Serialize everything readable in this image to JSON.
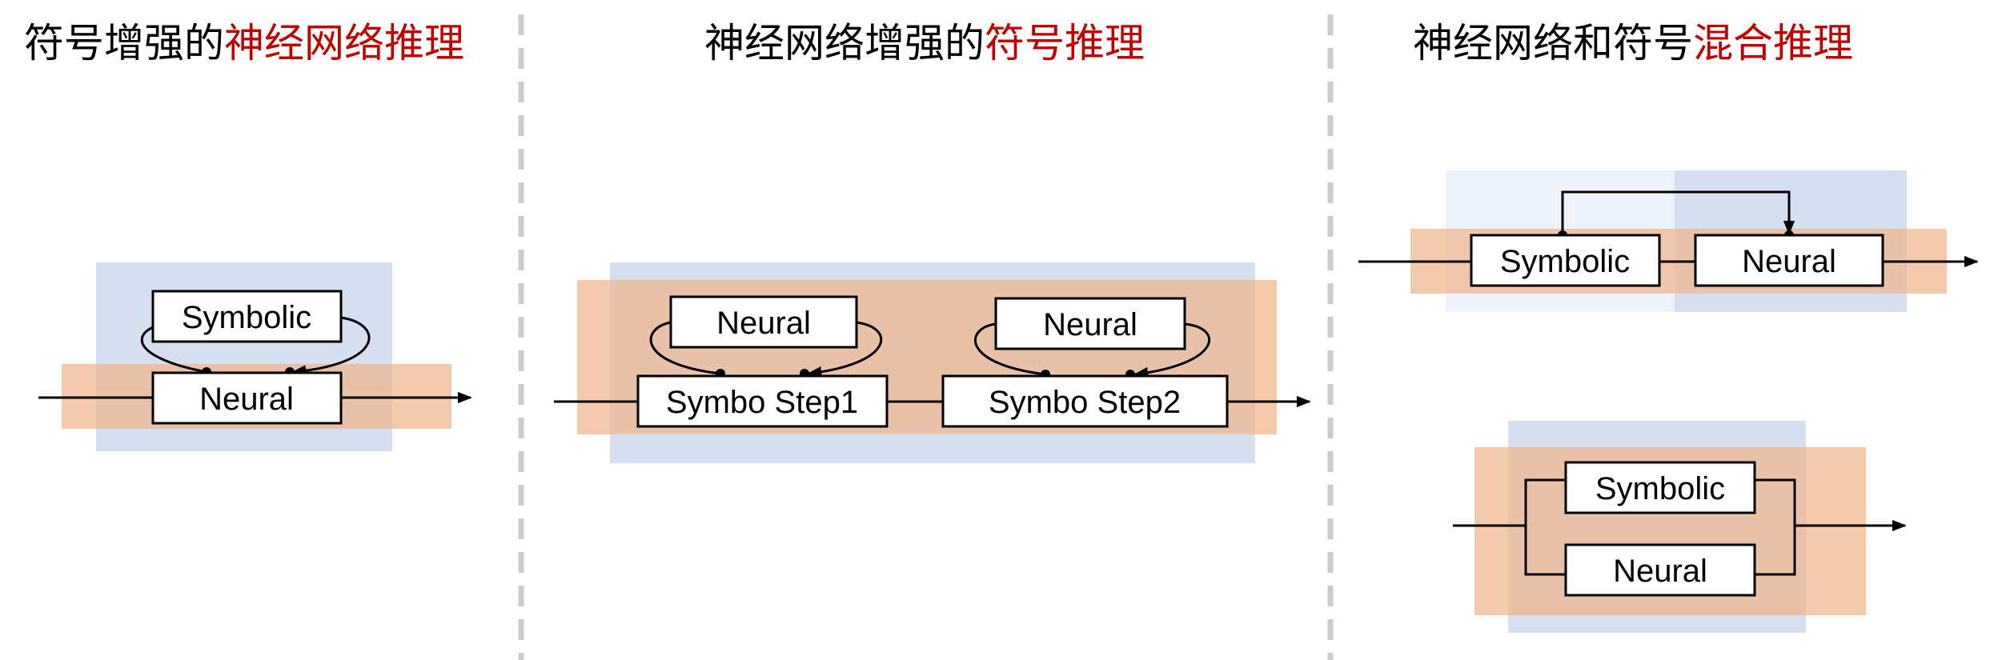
{
  "titles": [
    {
      "prefix": "符号增强的",
      "highlight": "神经网络推理"
    },
    {
      "prefix": "神经网络增强的",
      "highlight": "符号推理"
    },
    {
      "prefix": "神经网络和符号",
      "highlight": "混合推理"
    }
  ],
  "colors": {
    "highlight": "#c00000",
    "neural_region": "#d6dff0",
    "symbolic_region": "#f4c7a8",
    "divider": "#cccccc"
  },
  "panel1": {
    "top_box": "Symbolic",
    "bottom_box": "Neural"
  },
  "panel2": {
    "step1": {
      "top_box": "Neural",
      "bottom_box": "Symbo Step1"
    },
    "step2": {
      "top_box": "Neural",
      "bottom_box": "Symbo Step2"
    }
  },
  "panel3": {
    "serial": {
      "left_box": "Symbolic",
      "right_box": "Neural"
    },
    "parallel": {
      "top_box": "Symbolic",
      "bottom_box": "Neural"
    }
  }
}
